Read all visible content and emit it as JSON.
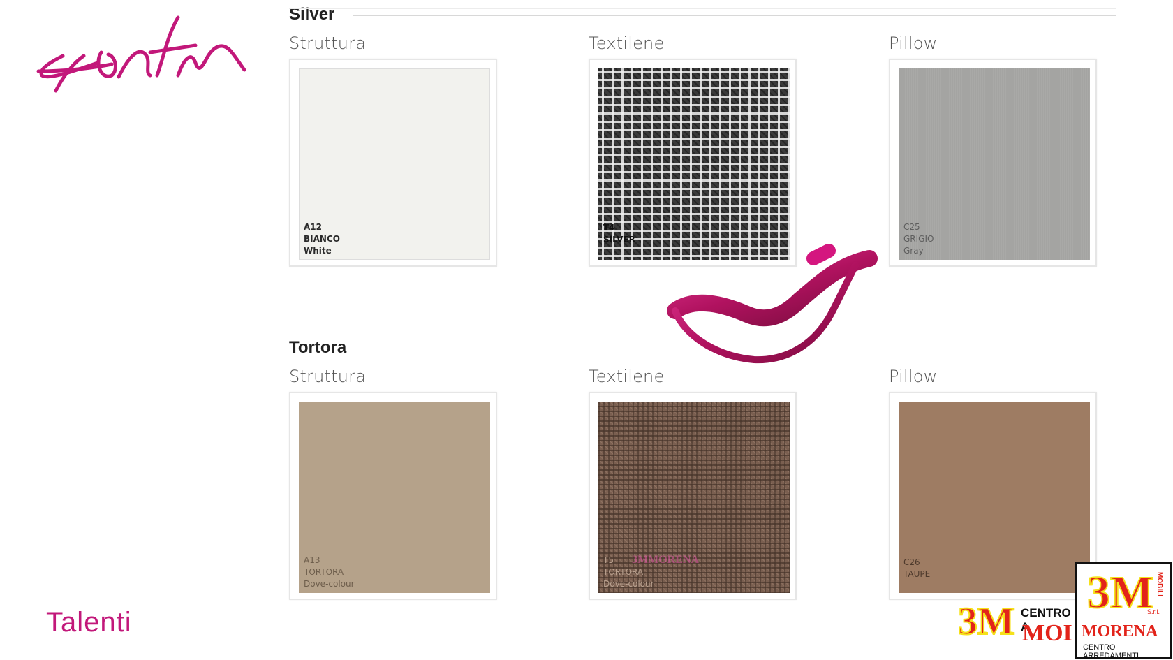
{
  "logos": {
    "signature_text": "Talenti",
    "brand_text": "Talenti",
    "dealer": {
      "mark": "3M",
      "side_text": "MOBILI",
      "srl": "S.r.l.",
      "name": "MORENA",
      "tagline": "CENTRO ARREDAMENTI",
      "partial_tagline": "CENTRO A",
      "partial_name": "MOI"
    },
    "watermark_text": "3MMORENA"
  },
  "sections": [
    {
      "title": "Silver",
      "columns": [
        {
          "label": "Struttura",
          "swatch": {
            "lines": [
              "A12",
              "BIANCO",
              "White"
            ],
            "color": "#f2f2ee"
          }
        },
        {
          "label": "Textilene",
          "swatch": {
            "lines": [
              "T4",
              "SILVER"
            ],
            "color": "#3a3a3a"
          }
        },
        {
          "label": "Pillow",
          "swatch": {
            "lines": [
              "C25",
              "GRIGIO",
              "Gray"
            ],
            "color": "#a4a4a2"
          }
        }
      ]
    },
    {
      "title": "Tortora",
      "columns": [
        {
          "label": "Struttura",
          "swatch": {
            "lines": [
              "A13",
              "TORTORA",
              "Dove-colour"
            ],
            "color": "#b5a28a"
          }
        },
        {
          "label": "Textilene",
          "swatch": {
            "lines": [
              "T5",
              "TORTORA",
              "Dove-colour"
            ],
            "color": "#7a5f50"
          }
        },
        {
          "label": "Pillow",
          "swatch": {
            "lines": [
              "C26",
              "TAUPE"
            ],
            "color": "#9e7c63"
          }
        }
      ]
    }
  ],
  "colors": {
    "brand_magenta": "#c2187a",
    "dealer_red": "#e2231a",
    "dealer_yellow": "#f5e11a",
    "lounger_magenta": "#d4167f"
  }
}
